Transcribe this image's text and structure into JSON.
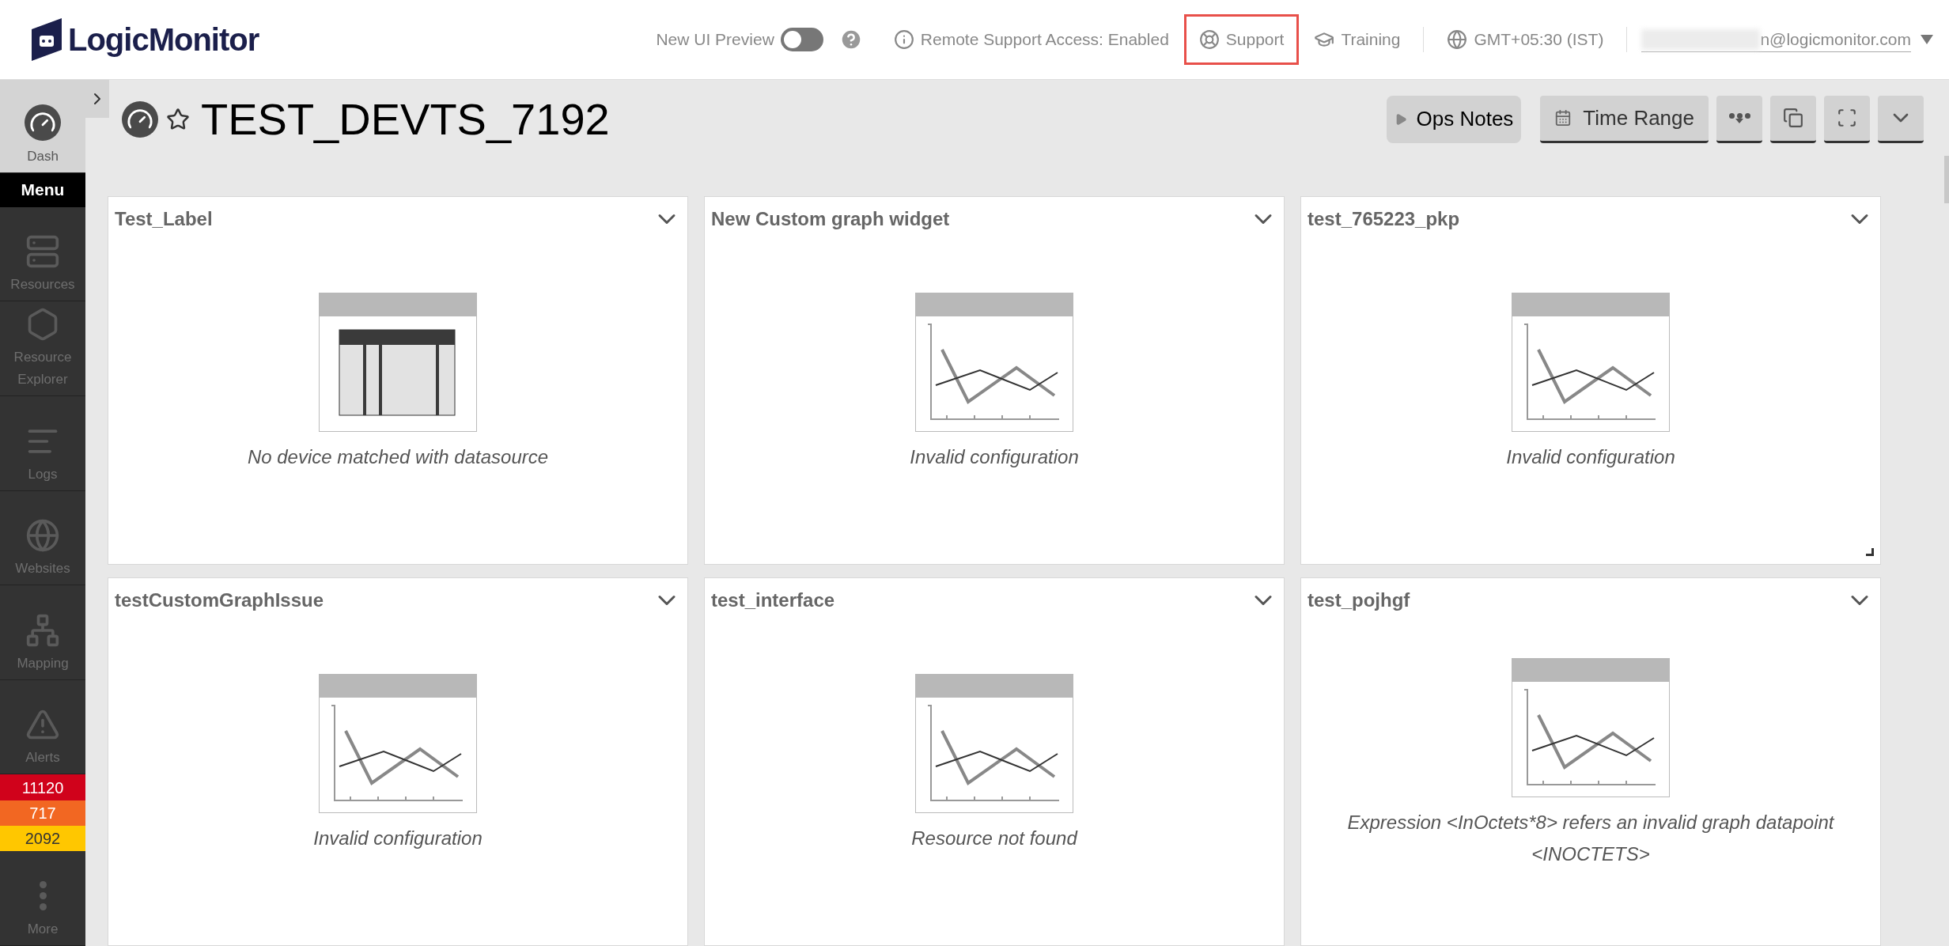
{
  "header": {
    "logo": "LogicMonitor",
    "preview_label": "New UI Preview",
    "preview_toggle": {
      "on": false
    },
    "links": [
      {
        "kind": "info",
        "label": "Remote Support Access: Enabled",
        "highlighted": false
      },
      {
        "kind": "support",
        "label": "Support",
        "highlighted": true
      },
      {
        "kind": "training",
        "label": "Training",
        "highlighted": false
      },
      {
        "kind": "timezone",
        "label": "GMT+05:30 (IST)",
        "highlighted": false
      }
    ],
    "account": "n@logicmonitor.com"
  },
  "sidebar": {
    "items": [
      {
        "kind": "dash",
        "label": "Dash",
        "selected": true
      },
      {
        "kind": "menu",
        "label": "Menu",
        "selected": false
      },
      {
        "kind": "resources",
        "label": "Resources",
        "selected": false
      },
      {
        "kind": "explorer",
        "label": "Resource Explorer",
        "selected": false
      },
      {
        "kind": "logs",
        "label": "Logs",
        "selected": false
      },
      {
        "kind": "websites",
        "label": "Websites",
        "selected": false
      },
      {
        "kind": "mapping",
        "label": "Mapping",
        "selected": false
      },
      {
        "kind": "alerts",
        "label": "Alerts",
        "selected": false
      },
      {
        "kind": "more",
        "label": "More",
        "selected": false
      }
    ],
    "alert_counts": [
      {
        "count": "11120",
        "color": "#d0021b"
      },
      {
        "count": "717",
        "color": "#f26722"
      },
      {
        "count": "2092",
        "color": "#ffc700"
      }
    ]
  },
  "dashboard": {
    "title": "TEST_DEVTS_7192",
    "favorite": false,
    "toolbar": [
      {
        "kind": "ops",
        "label": "Ops Notes"
      },
      {
        "kind": "time",
        "label": "Time Range"
      },
      {
        "kind": "filter"
      },
      {
        "kind": "slideshow"
      },
      {
        "kind": "fullscreen"
      },
      {
        "kind": "more"
      }
    ]
  },
  "widgets": [
    {
      "title": "Test_Label",
      "kind": "table",
      "message": "No device matched with datasource",
      "resizable": false
    },
    {
      "title": "New Custom graph widget",
      "kind": "graph",
      "message": "Invalid configuration",
      "resizable": false
    },
    {
      "title": "test_765223_pkp",
      "kind": "graph",
      "message": "Invalid configuration",
      "resizable": true
    },
    {
      "title": "testCustomGraphIssue",
      "kind": "graph",
      "message": "Invalid configuration",
      "resizable": false
    },
    {
      "title": "test_interface",
      "kind": "graph",
      "message": "Resource not found",
      "resizable": false
    },
    {
      "title": "test_pojhgf",
      "kind": "graph",
      "message": "Expression <InOctets*8> refers an invalid graph datapoint <INOCTETS>",
      "resizable": false
    }
  ]
}
